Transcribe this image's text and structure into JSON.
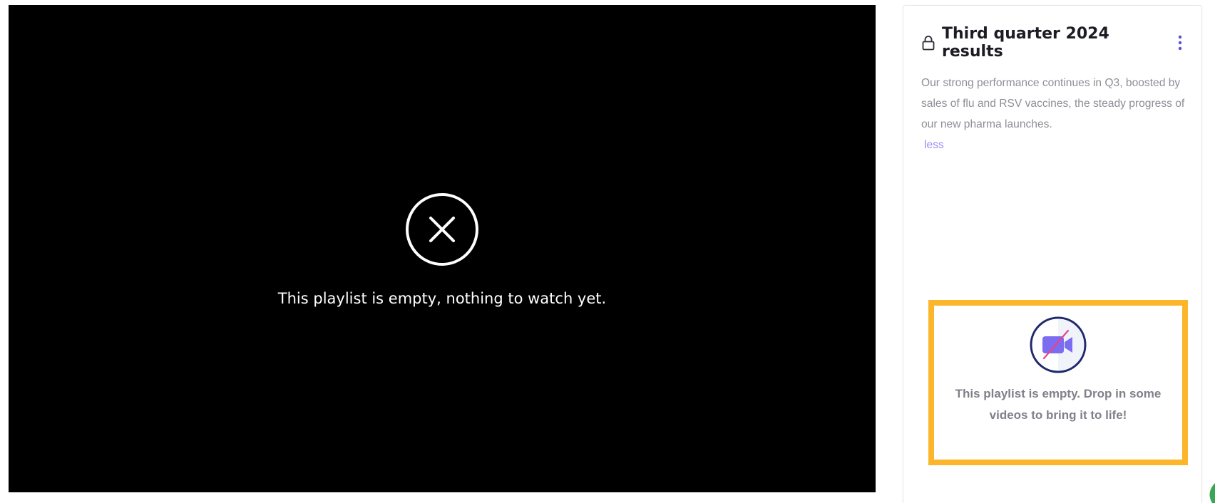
{
  "player": {
    "empty_message": "This playlist is empty, nothing to watch yet.",
    "icon": "close-circle-icon",
    "background": "#000000"
  },
  "panel": {
    "title": "Third quarter 2024 results",
    "lock_icon": "lock-icon",
    "menu_icon": "more-vertical-icon",
    "description": "Our strong performance continues in Q3, boosted by sales of flu and RSV vaccines, the steady progress of our new pharma launches.",
    "less_label": "less",
    "accent_color": "#6b5be2"
  },
  "empty_card": {
    "icon": "video-off-icon",
    "message": "This playlist is empty. Drop in some videos to bring it to life!",
    "highlight_color": "#fbb62c"
  }
}
